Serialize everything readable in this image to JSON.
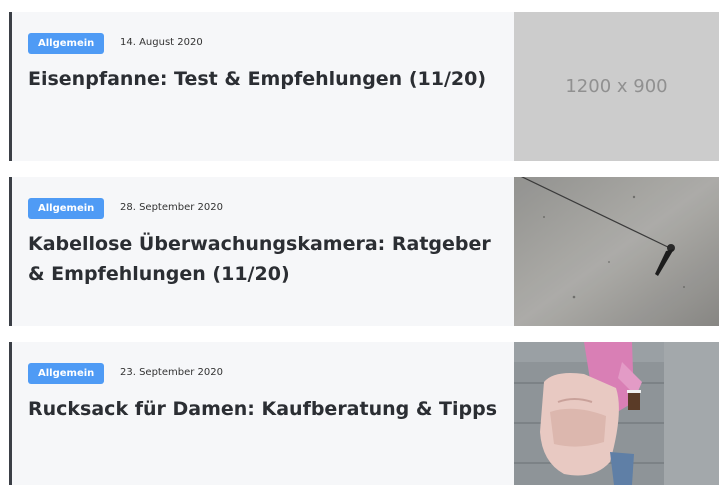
{
  "articles": [
    {
      "category": "Allgemein",
      "date": "14. August 2020",
      "title": "Eisenpfanne: Test & Empfehlungen (11/20)",
      "image_text": "1200 x 900"
    },
    {
      "category": "Allgemein",
      "date": "28. September 2020",
      "title": "Kabellose Überwachungskamera: Ratgeber & Empfehlungen (11/20)"
    },
    {
      "category": "Allgemein",
      "date": "23. September 2020",
      "title": "Rucksack für Damen: Kaufberatung & Tipps"
    }
  ],
  "colors": {
    "badge": "#4f9bf5",
    "card_bg": "#f6f7f9",
    "accent_border": "#3b3f46"
  }
}
